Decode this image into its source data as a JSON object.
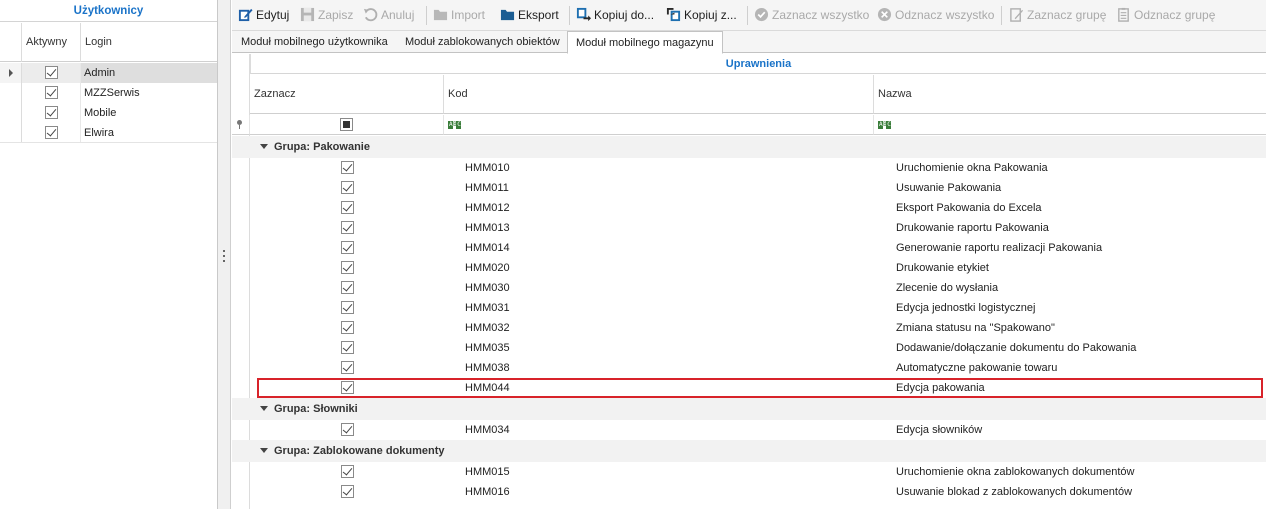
{
  "left_panel": {
    "title": "Użytkownicy",
    "columns": [
      "Aktywny",
      "Login"
    ],
    "users": [
      {
        "login": "Admin",
        "active": true,
        "selected": true
      },
      {
        "login": "MZZSerwis",
        "active": true,
        "selected": false
      },
      {
        "login": "Mobile",
        "active": true,
        "selected": false
      },
      {
        "login": "Elwira",
        "active": true,
        "selected": false
      }
    ]
  },
  "toolbar": {
    "edit": "Edytuj",
    "save": "Zapisz",
    "cancel": "Anuluj",
    "import": "Import",
    "export": "Eksport",
    "copy_to": "Kopiuj do...",
    "copy_from": "Kopiuj z...",
    "select_all": "Zaznacz wszystko",
    "deselect_all": "Odznacz wszystko",
    "select_group": "Zaznacz grupę",
    "deselect_group": "Odznacz grupę"
  },
  "tabs": [
    {
      "label": "Moduł mobilnego użytkownika",
      "active": false
    },
    {
      "label": "Moduł zablokowanych obiektów",
      "active": false
    },
    {
      "label": "Moduł mobilnego magazynu",
      "active": true
    }
  ],
  "grid": {
    "band_title": "Uprawnienia",
    "columns": {
      "select": "Zaznacz",
      "code": "Kod",
      "name": "Nazwa"
    },
    "groups": [
      {
        "label": "Grupa: Pakowanie",
        "rows": [
          {
            "code": "HMM010",
            "name": "Uruchomienie okna Pakowania",
            "checked": true
          },
          {
            "code": "HMM011",
            "name": "Usuwanie Pakowania",
            "checked": true
          },
          {
            "code": "HMM012",
            "name": "Eksport Pakowania do Excela",
            "checked": true
          },
          {
            "code": "HMM013",
            "name": "Drukowanie raportu Pakowania",
            "checked": true
          },
          {
            "code": "HMM014",
            "name": "Generowanie raportu realizacji Pakowania",
            "checked": true
          },
          {
            "code": "HMM020",
            "name": "Drukowanie etykiet",
            "checked": true
          },
          {
            "code": "HMM030",
            "name": "Zlecenie do wysłania",
            "checked": true
          },
          {
            "code": "HMM031",
            "name": "Edycja jednostki logistycznej",
            "checked": true
          },
          {
            "code": "HMM032",
            "name": "Zmiana statusu na \"Spakowano\"",
            "checked": true
          },
          {
            "code": "HMM035",
            "name": "Dodawanie/dołączanie dokumentu do Pakowania",
            "checked": true
          },
          {
            "code": "HMM038",
            "name": "Automatyczne pakowanie towaru",
            "checked": true
          },
          {
            "code": "HMM044",
            "name": "Edycja pakowania",
            "checked": true,
            "highlighted": true
          }
        ]
      },
      {
        "label": "Grupa: Słowniki",
        "rows": [
          {
            "code": "HMM034",
            "name": "Edycja słowników",
            "checked": true
          }
        ]
      },
      {
        "label": "Grupa: Zablokowane dokumenty",
        "rows": [
          {
            "code": "HMM015",
            "name": "Uruchomienie okna zablokowanych dokumentów",
            "checked": true
          },
          {
            "code": "HMM016",
            "name": "Usuwanie blokad z zablokowanych dokumentów",
            "checked": true
          }
        ]
      }
    ]
  },
  "colors": {
    "accent": "#1a73c8",
    "highlight_border": "#d8232a",
    "group_bg": "#f2f2f2",
    "selected_row": "#dedede"
  }
}
